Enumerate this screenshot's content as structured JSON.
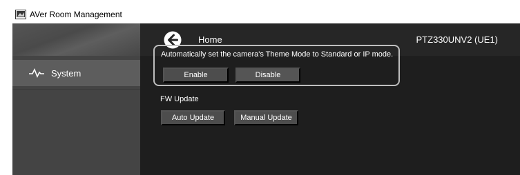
{
  "window": {
    "title": "AVer Room Management"
  },
  "topbar": {
    "home_label": "Home",
    "device_name": "PTZ330UNV2 (UE1)"
  },
  "sidebar": {
    "items": [
      {
        "label": "System",
        "icon": "pulse-icon"
      }
    ]
  },
  "theme_mode": {
    "description": "Automatically set the camera's Theme Mode to Standard or IP mode.",
    "enable_label": "Enable",
    "disable_label": "Disable"
  },
  "fw_update": {
    "label": "FW Update",
    "auto_label": "Auto Update",
    "manual_label": "Manual Update"
  }
}
